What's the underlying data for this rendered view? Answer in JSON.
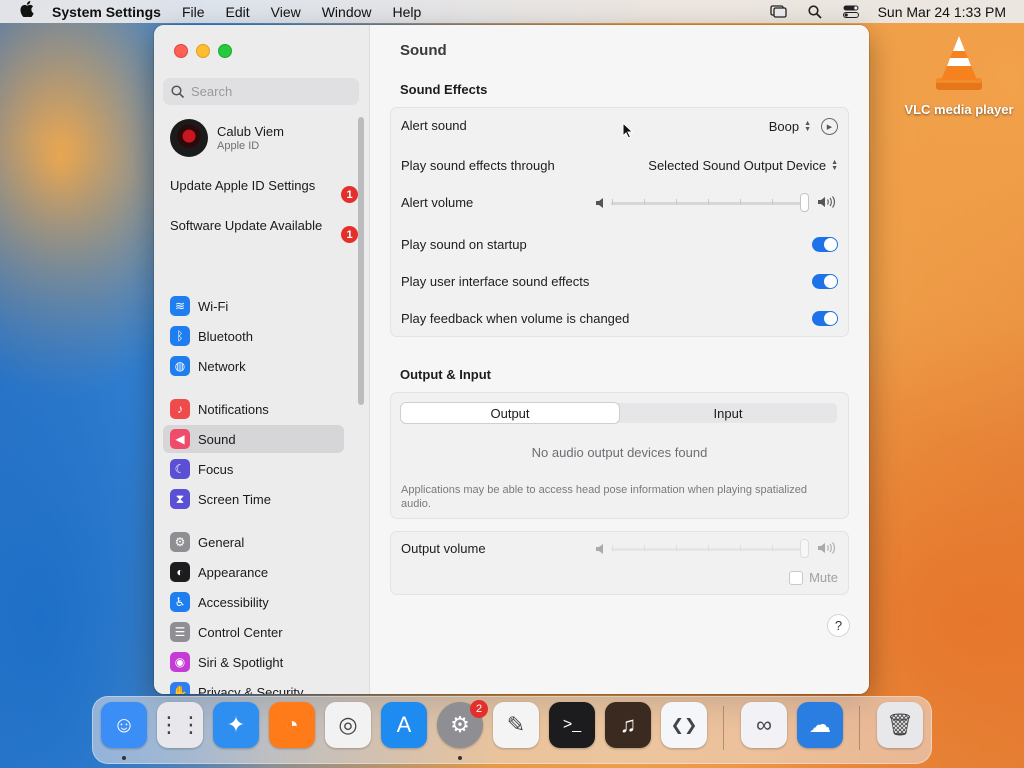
{
  "menubar": {
    "app_name": "System Settings",
    "items": [
      "File",
      "Edit",
      "View",
      "Window",
      "Help"
    ],
    "datetime": "Sun Mar 24  1:33 PM"
  },
  "desktop": {
    "icons": [
      {
        "label": "VLC media player",
        "icon": "vlc-cone-icon"
      }
    ]
  },
  "sidebar": {
    "search_placeholder": "Search",
    "account": {
      "name": "Calub Viem",
      "subtitle": "Apple ID"
    },
    "notices": [
      {
        "label": "Update Apple ID Settings",
        "badge": "1"
      },
      {
        "label": "Software Update Available",
        "badge": "1"
      }
    ],
    "items": [
      {
        "label": "Wi-Fi",
        "icon": "wifi-icon",
        "color": "#1e7ef0"
      },
      {
        "label": "Bluetooth",
        "icon": "bluetooth-icon",
        "color": "#1e7ef0"
      },
      {
        "label": "Network",
        "icon": "globe-icon",
        "color": "#1e7ef0"
      },
      {
        "label": "Notifications",
        "icon": "bell-icon",
        "color": "#ef4b4b"
      },
      {
        "label": "Sound",
        "icon": "speaker-icon",
        "color": "#ef4b6b"
      },
      {
        "label": "Focus",
        "icon": "moon-icon",
        "color": "#5b4fd6"
      },
      {
        "label": "Screen Time",
        "icon": "hourglass-icon",
        "color": "#5b4fd6"
      },
      {
        "label": "General",
        "icon": "gear-icon",
        "color": "#8e8e93"
      },
      {
        "label": "Appearance",
        "icon": "appearance-icon",
        "color": "#1c1c1e"
      },
      {
        "label": "Accessibility",
        "icon": "accessibility-icon",
        "color": "#1e7ef0"
      },
      {
        "label": "Control Center",
        "icon": "control-center-icon",
        "color": "#8e8e93"
      },
      {
        "label": "Siri & Spotlight",
        "icon": "siri-icon",
        "color": "#c43bd6"
      },
      {
        "label": "Privacy & Security",
        "icon": "hand-icon",
        "color": "#2f7ef0"
      }
    ]
  },
  "content": {
    "title": "Sound",
    "sound_effects": {
      "heading": "Sound Effects",
      "alert_sound_label": "Alert sound",
      "alert_sound_value": "Boop",
      "output_through_label": "Play sound effects through",
      "output_through_value": "Selected Sound Output Device",
      "alert_volume_label": "Alert volume",
      "alert_volume_level": 1.0,
      "startup_label": "Play sound on startup",
      "startup_on": true,
      "ui_effects_label": "Play user interface sound effects",
      "ui_effects_on": true,
      "feedback_label": "Play feedback when volume is changed",
      "feedback_on": true
    },
    "output_input": {
      "heading": "Output & Input",
      "tabs": [
        "Output",
        "Input"
      ],
      "active_tab": "Output",
      "empty_message": "No audio output devices found",
      "fine_print": "Applications may be able to access head pose information when playing spatialized audio."
    },
    "output_volume": {
      "label": "Output volume",
      "level": 1.0,
      "mute_label": "Mute",
      "muted": false
    },
    "help_label": "?"
  },
  "dock": {
    "apps": [
      {
        "name": "Finder",
        "icon": "finder-icon",
        "color": "#3a8ef5",
        "running": true
      },
      {
        "name": "Launchpad",
        "icon": "launchpad-icon",
        "color": "#e8e8ec",
        "running": false
      },
      {
        "name": "Safari",
        "icon": "safari-icon",
        "color": "#2f8ff0",
        "running": false
      },
      {
        "name": "Firefox",
        "icon": "firefox-icon",
        "color": "#ff7a18",
        "running": false
      },
      {
        "name": "Chrome",
        "icon": "chrome-icon",
        "color": "#f2f2f2",
        "running": false
      },
      {
        "name": "App Store",
        "icon": "app-store-icon",
        "color": "#1e8bf0",
        "running": false
      },
      {
        "name": "System Settings",
        "icon": "system-settings-icon",
        "color": "#8e8e93",
        "running": true,
        "badge": "2"
      },
      {
        "name": "TextEdit",
        "icon": "textedit-icon",
        "color": "#f4f4f4",
        "running": false
      },
      {
        "name": "Terminal",
        "icon": "terminal-icon",
        "color": "#1c1c1e",
        "running": false
      },
      {
        "name": "GarageBand",
        "icon": "garageband-icon",
        "color": "#3b2a1f",
        "running": false
      },
      {
        "name": "Visual Studio Code",
        "icon": "vscode-icon",
        "color": "#f4f6f9",
        "running": false
      },
      {
        "name": "Visual Studio",
        "icon": "visual-studio-icon",
        "color": "#f2f2f6",
        "running": false
      },
      {
        "name": "Weather",
        "icon": "weather-icon",
        "color": "#2a7de1",
        "running": false
      },
      {
        "name": "Trash",
        "icon": "trash-icon",
        "color": "#e8e8ea",
        "running": false
      }
    ]
  }
}
